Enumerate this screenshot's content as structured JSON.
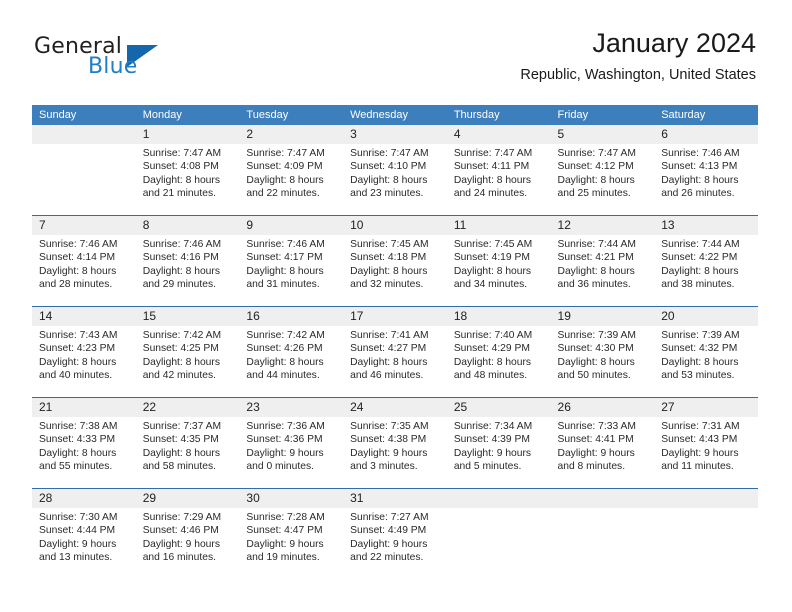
{
  "brand": {
    "name_part1": "General",
    "name_part2": "Blue",
    "accent_color": "#1666ab",
    "text_color": "#231f20"
  },
  "header": {
    "title": "January 2024",
    "subtitle": "Republic, Washington, United States"
  },
  "calendar": {
    "header_bg": "#3d7ebd",
    "daynum_bg": "#efefef",
    "rule_color": "#2f6ea8",
    "weekdays": [
      "Sunday",
      "Monday",
      "Tuesday",
      "Wednesday",
      "Thursday",
      "Friday",
      "Saturday"
    ],
    "weeks": [
      {
        "days": [
          {
            "num": "",
            "lines": []
          },
          {
            "num": "1",
            "lines": [
              "Sunrise: 7:47 AM",
              "Sunset: 4:08 PM",
              "Daylight: 8 hours",
              "and 21 minutes."
            ]
          },
          {
            "num": "2",
            "lines": [
              "Sunrise: 7:47 AM",
              "Sunset: 4:09 PM",
              "Daylight: 8 hours",
              "and 22 minutes."
            ]
          },
          {
            "num": "3",
            "lines": [
              "Sunrise: 7:47 AM",
              "Sunset: 4:10 PM",
              "Daylight: 8 hours",
              "and 23 minutes."
            ]
          },
          {
            "num": "4",
            "lines": [
              "Sunrise: 7:47 AM",
              "Sunset: 4:11 PM",
              "Daylight: 8 hours",
              "and 24 minutes."
            ]
          },
          {
            "num": "5",
            "lines": [
              "Sunrise: 7:47 AM",
              "Sunset: 4:12 PM",
              "Daylight: 8 hours",
              "and 25 minutes."
            ]
          },
          {
            "num": "6",
            "lines": [
              "Sunrise: 7:46 AM",
              "Sunset: 4:13 PM",
              "Daylight: 8 hours",
              "and 26 minutes."
            ]
          }
        ]
      },
      {
        "days": [
          {
            "num": "7",
            "lines": [
              "Sunrise: 7:46 AM",
              "Sunset: 4:14 PM",
              "Daylight: 8 hours",
              "and 28 minutes."
            ]
          },
          {
            "num": "8",
            "lines": [
              "Sunrise: 7:46 AM",
              "Sunset: 4:16 PM",
              "Daylight: 8 hours",
              "and 29 minutes."
            ]
          },
          {
            "num": "9",
            "lines": [
              "Sunrise: 7:46 AM",
              "Sunset: 4:17 PM",
              "Daylight: 8 hours",
              "and 31 minutes."
            ]
          },
          {
            "num": "10",
            "lines": [
              "Sunrise: 7:45 AM",
              "Sunset: 4:18 PM",
              "Daylight: 8 hours",
              "and 32 minutes."
            ]
          },
          {
            "num": "11",
            "lines": [
              "Sunrise: 7:45 AM",
              "Sunset: 4:19 PM",
              "Daylight: 8 hours",
              "and 34 minutes."
            ]
          },
          {
            "num": "12",
            "lines": [
              "Sunrise: 7:44 AM",
              "Sunset: 4:21 PM",
              "Daylight: 8 hours",
              "and 36 minutes."
            ]
          },
          {
            "num": "13",
            "lines": [
              "Sunrise: 7:44 AM",
              "Sunset: 4:22 PM",
              "Daylight: 8 hours",
              "and 38 minutes."
            ]
          }
        ]
      },
      {
        "days": [
          {
            "num": "14",
            "lines": [
              "Sunrise: 7:43 AM",
              "Sunset: 4:23 PM",
              "Daylight: 8 hours",
              "and 40 minutes."
            ]
          },
          {
            "num": "15",
            "lines": [
              "Sunrise: 7:42 AM",
              "Sunset: 4:25 PM",
              "Daylight: 8 hours",
              "and 42 minutes."
            ]
          },
          {
            "num": "16",
            "lines": [
              "Sunrise: 7:42 AM",
              "Sunset: 4:26 PM",
              "Daylight: 8 hours",
              "and 44 minutes."
            ]
          },
          {
            "num": "17",
            "lines": [
              "Sunrise: 7:41 AM",
              "Sunset: 4:27 PM",
              "Daylight: 8 hours",
              "and 46 minutes."
            ]
          },
          {
            "num": "18",
            "lines": [
              "Sunrise: 7:40 AM",
              "Sunset: 4:29 PM",
              "Daylight: 8 hours",
              "and 48 minutes."
            ]
          },
          {
            "num": "19",
            "lines": [
              "Sunrise: 7:39 AM",
              "Sunset: 4:30 PM",
              "Daylight: 8 hours",
              "and 50 minutes."
            ]
          },
          {
            "num": "20",
            "lines": [
              "Sunrise: 7:39 AM",
              "Sunset: 4:32 PM",
              "Daylight: 8 hours",
              "and 53 minutes."
            ]
          }
        ]
      },
      {
        "days": [
          {
            "num": "21",
            "lines": [
              "Sunrise: 7:38 AM",
              "Sunset: 4:33 PM",
              "Daylight: 8 hours",
              "and 55 minutes."
            ]
          },
          {
            "num": "22",
            "lines": [
              "Sunrise: 7:37 AM",
              "Sunset: 4:35 PM",
              "Daylight: 8 hours",
              "and 58 minutes."
            ]
          },
          {
            "num": "23",
            "lines": [
              "Sunrise: 7:36 AM",
              "Sunset: 4:36 PM",
              "Daylight: 9 hours",
              "and 0 minutes."
            ]
          },
          {
            "num": "24",
            "lines": [
              "Sunrise: 7:35 AM",
              "Sunset: 4:38 PM",
              "Daylight: 9 hours",
              "and 3 minutes."
            ]
          },
          {
            "num": "25",
            "lines": [
              "Sunrise: 7:34 AM",
              "Sunset: 4:39 PM",
              "Daylight: 9 hours",
              "and 5 minutes."
            ]
          },
          {
            "num": "26",
            "lines": [
              "Sunrise: 7:33 AM",
              "Sunset: 4:41 PM",
              "Daylight: 9 hours",
              "and 8 minutes."
            ]
          },
          {
            "num": "27",
            "lines": [
              "Sunrise: 7:31 AM",
              "Sunset: 4:43 PM",
              "Daylight: 9 hours",
              "and 11 minutes."
            ]
          }
        ]
      },
      {
        "days": [
          {
            "num": "28",
            "lines": [
              "Sunrise: 7:30 AM",
              "Sunset: 4:44 PM",
              "Daylight: 9 hours",
              "and 13 minutes."
            ]
          },
          {
            "num": "29",
            "lines": [
              "Sunrise: 7:29 AM",
              "Sunset: 4:46 PM",
              "Daylight: 9 hours",
              "and 16 minutes."
            ]
          },
          {
            "num": "30",
            "lines": [
              "Sunrise: 7:28 AM",
              "Sunset: 4:47 PM",
              "Daylight: 9 hours",
              "and 19 minutes."
            ]
          },
          {
            "num": "31",
            "lines": [
              "Sunrise: 7:27 AM",
              "Sunset: 4:49 PM",
              "Daylight: 9 hours",
              "and 22 minutes."
            ]
          },
          {
            "num": "",
            "lines": []
          },
          {
            "num": "",
            "lines": []
          },
          {
            "num": "",
            "lines": []
          }
        ]
      }
    ]
  }
}
